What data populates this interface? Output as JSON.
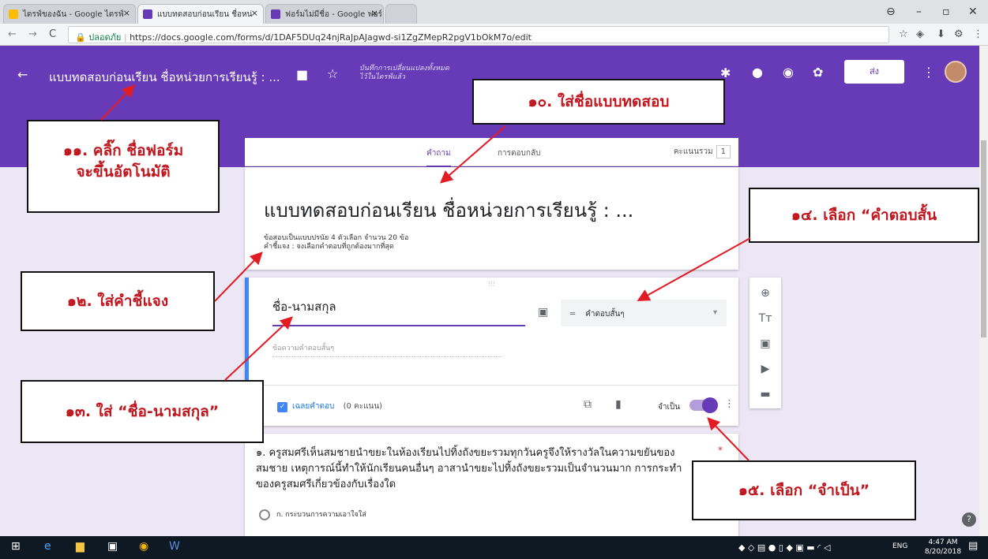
{
  "browser": {
    "tabs": [
      "ไดรฟ์ของฉัน - Google ไดรฟ์",
      "แบบทดสอบก่อนเรียน ชื่อหน่",
      "ฟอร์มไม่มีชื่อ - Google ฟอร์"
    ],
    "secure_label": "ปลอดภัย",
    "url": "https://docs.google.com/forms/d/1DAF5DUq24njRaJpAJagwd-si1ZgZMepR2pgV1bOkM7o/edit"
  },
  "header": {
    "title": "แบบทดสอบก่อนเรียน ชื่อหน่วยการเรียนรู้ : ...",
    "save_status": "บันทึกการเปลี่ยนแปลงทั้งหมดไว้ในไดรฟ์แล้ว",
    "send": "ส่ง"
  },
  "tabs": {
    "questions": "คำถาม",
    "responses": "การตอบกลับ",
    "total_label": "คะแนนรวม",
    "total": "1"
  },
  "form": {
    "title": "แบบทดสอบก่อนเรียน ชื่อหน่วยการเรียนรู้ : ...",
    "desc1": "ข้อสอบเป็นแบบปรนัย 4 ตัวเลือก จำนวน 20 ข้อ",
    "desc2": "คำชี้แจง : จงเลือกคำตอบที่ถูกต้องมากที่สุด"
  },
  "question": {
    "title": "ชื่อ-นามสกุล",
    "hint": "ข้อความคำตอบสั้นๆ",
    "type": "คำตอบสั้นๆ",
    "answer_key": "เฉลยคำตอบ",
    "points": "(0 คะแนน)",
    "required": "จำเป็น"
  },
  "question1": {
    "text": "๑. ครูสมศรีเห็นสมชายนำขยะในห้องเรียนไปทิ้งถังขยะรวมทุกวันครูจึงให้รางวัลในความขยันของสมชาย เหตุการณ์นี้ทำให้นักเรียนคนอื่นๆ อาสานำขยะไปทิ้งถังขยะรวมเป็นจำนวนมาก การกระทำของครูสมศรีเกี่ยวข้องกับเรื่องใด",
    "option_a": "ก. กระบวนการความเอาใจใส่"
  },
  "notes": {
    "n10": "๑๐. ใส่ชื่อแบบทดสอบ",
    "n11a": "๑๑. คลิ๊ก ชื่อฟอร์ม",
    "n11b": "จะขึ้นอัตโนมัติ",
    "n12": "๑๒. ใส่คำชี้แจง",
    "n13": "๑๓. ใส่ “ชื่อ-นามสกุล”",
    "n14": "๑๔. เลือก “คำตอบสั้น",
    "n15": "๑๕. เลือก “จำเป็น”"
  },
  "taskbar": {
    "lang": "ENG",
    "time": "4:47 AM",
    "date": "8/20/2018"
  },
  "colors": {
    "theme": "#673ab7",
    "annotation": "#c0171f",
    "taskbar": "#0f1923"
  }
}
